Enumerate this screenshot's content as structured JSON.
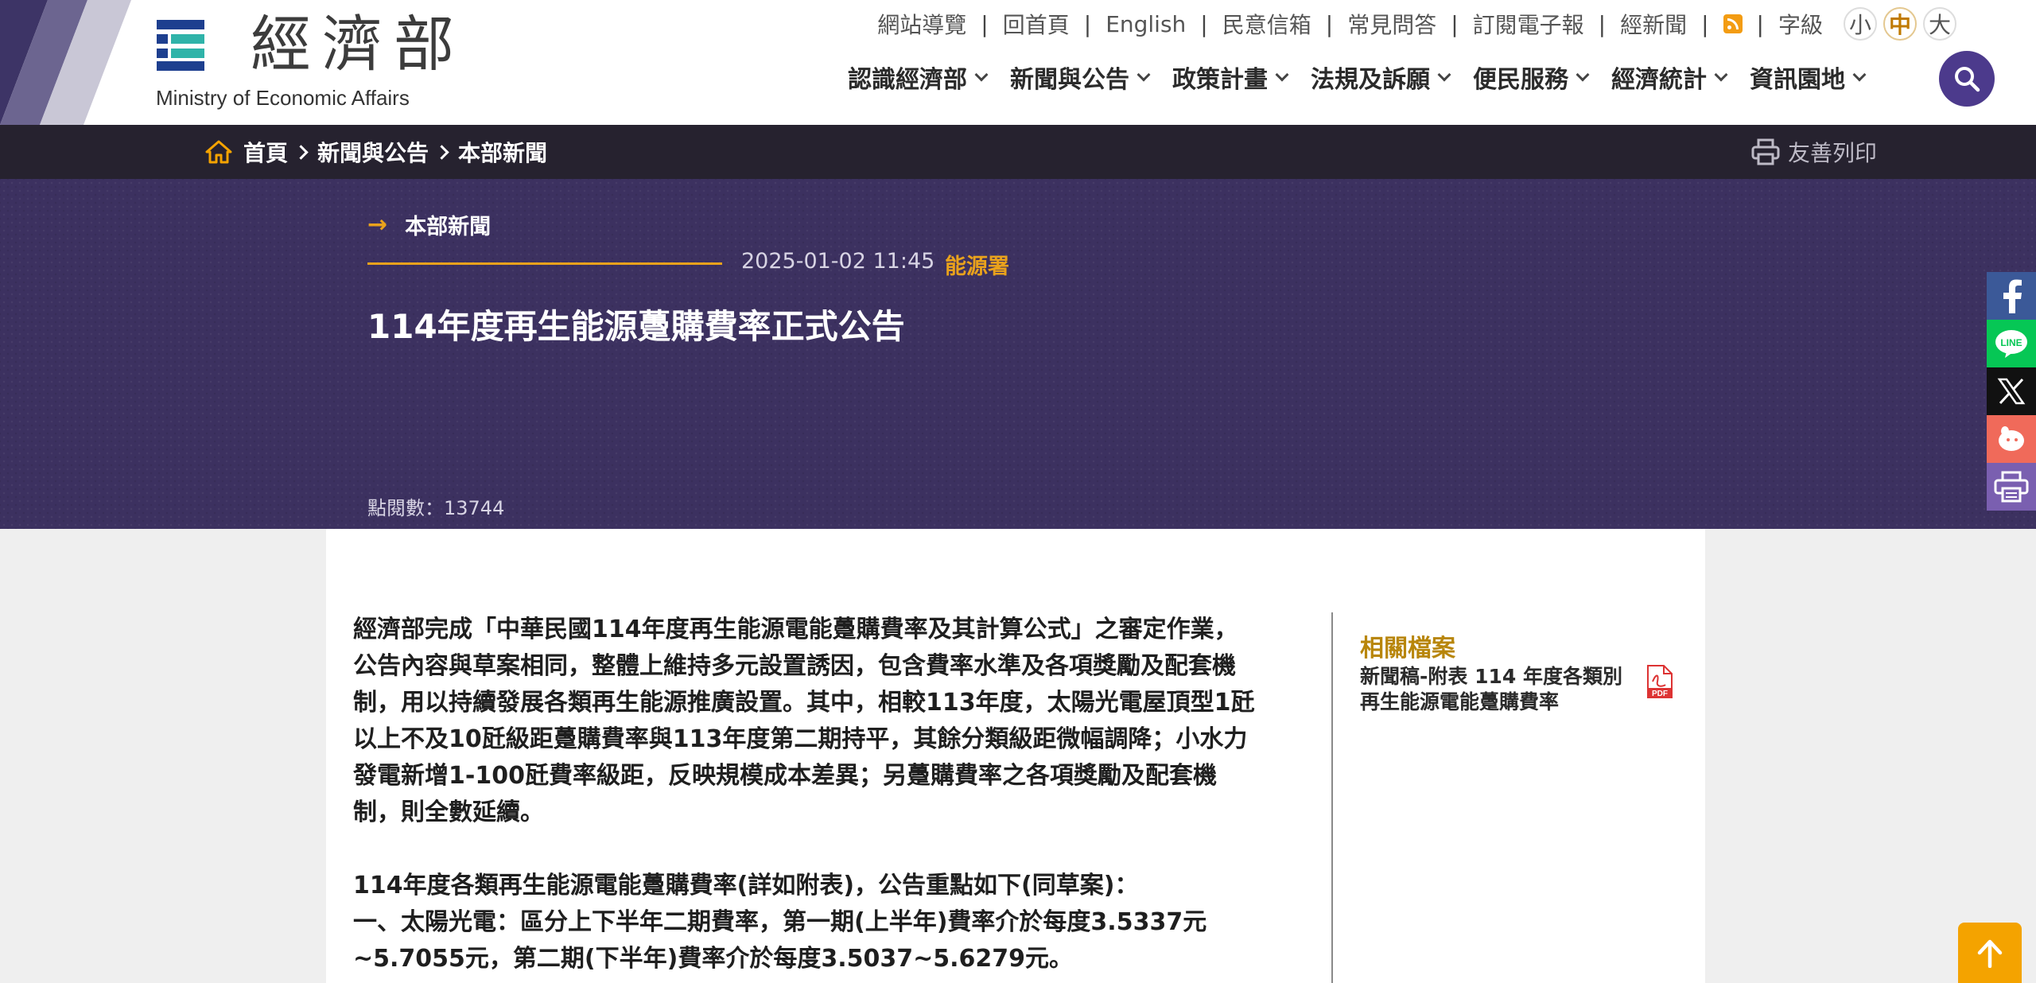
{
  "header": {
    "logo_cn": "經濟部",
    "logo_en": "Ministry of Economic Affairs",
    "utility_links": [
      "網站導覽",
      "回首頁",
      "English",
      "民意信箱",
      "常見問答",
      "訂閱電子報",
      "經新聞"
    ],
    "font_size_label": "字級",
    "font_sizes": [
      "小",
      "中",
      "大"
    ],
    "main_nav": [
      "認識經濟部",
      "新聞與公告",
      "政策計畫",
      "法規及訴願",
      "便民服務",
      "經濟統計",
      "資訊園地"
    ]
  },
  "breadcrumb": {
    "items": [
      "首頁",
      "新聞與公告",
      "本部新聞"
    ],
    "print_label": "友善列印"
  },
  "hero": {
    "section": "本部新聞",
    "date": "2025-01-02 11:45",
    "agency": "能源署",
    "title": "114年度再生能源躉購費率正式公告",
    "views": "點閱數：13744"
  },
  "article": {
    "paragraph1_lines": [
      "經濟部完成「中華民國114年度再生能源電能躉購費率及其計算公式」之審定作業，",
      "公告內容與草案相同，整體上維持多元設置誘因，包含費率水準及各項獎勵及配套機",
      "制，用以持續發展各類再生能源推廣設置。其中，相較113年度，太陽光電屋頂型1瓩",
      "以上不及10瓩級距躉購費率與113年度第二期持平，其餘分類級距微幅調降；小水力",
      "發電新增1-100瓩費率級距，反映規模成本差異；另躉購費率之各項獎勵及配套機",
      "制，則全數延續。"
    ],
    "paragraph2_lines": [
      "114年度各類再生能源電能躉購費率(詳如附表)，公告重點如下(同草案)：",
      "一、太陽光電：區分上下半年二期費率，第一期(上半年)費率介於每度3.5337元",
      "~5.7055元，第二期(下半年)費率介於每度3.5037~5.6279元。"
    ]
  },
  "related": {
    "title": "相關檔案",
    "file_line1": "新聞稿-附表 114 年度各類別",
    "file_line2": "再生能源電能躉購費率",
    "file_type": "PDF"
  },
  "colors": {
    "brand_purple": "#4c3a8c",
    "hero_bg": "#3c3160",
    "accent_orange": "#e9a21c"
  }
}
